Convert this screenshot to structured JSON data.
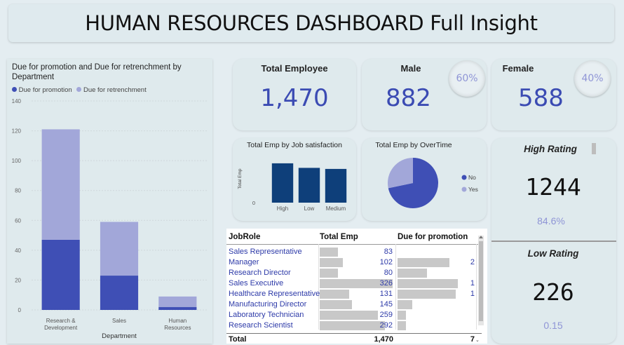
{
  "header": {
    "title": "HUMAN RESOURCES DASHBOARD Full Insight"
  },
  "kpis": {
    "total_employee": {
      "label": "Total Employee",
      "value": "1,470"
    },
    "male": {
      "label": "Male",
      "value": "882",
      "pct": "60%"
    },
    "female": {
      "label": "Female",
      "value": "588",
      "pct": "40%"
    },
    "high_rating": {
      "label": "High Rating",
      "value": "1244",
      "pct": "84.6%"
    },
    "low_rating": {
      "label": "Low Rating",
      "value": "226",
      "pct": "0.15"
    }
  },
  "colors": {
    "dark_blue": "#3f4fb5",
    "light_blue": "#a2a7d9",
    "navy": "#0e3f7a",
    "gray_bar": "#c8c8c8"
  },
  "chart_data": [
    {
      "type": "bar",
      "stacked": true,
      "title": "Due for promotion and Due for retrenchment by Department",
      "xlabel": "Department",
      "ylabel": "",
      "ylim": [
        0,
        140
      ],
      "yticks": [
        "0",
        "20",
        "40",
        "60",
        "80",
        "100",
        "120",
        "140"
      ],
      "categories": [
        "Research & Development",
        "Sales",
        "Human Resources"
      ],
      "category_lines": [
        [
          "Research &",
          "Development"
        ],
        [
          "Sales"
        ],
        [
          "Human",
          "Resources"
        ]
      ],
      "series": [
        {
          "name": "Due for promotion",
          "values": [
            47,
            23,
            2
          ]
        },
        {
          "name": "Due for retrenchment",
          "values": [
            74,
            36,
            7
          ]
        }
      ],
      "legend_position": "top-left"
    },
    {
      "type": "bar",
      "title": "Total Emp by Job satisfaction",
      "ylabel": "Total Emp",
      "yticks": [
        "0"
      ],
      "ylim": [
        0,
        700
      ],
      "categories": [
        "High",
        "Low",
        "Medium"
      ],
      "values": [
        561,
        496,
        481
      ]
    },
    {
      "type": "pie",
      "title": "Total Emp by OverTime",
      "categories": [
        "No",
        "Yes"
      ],
      "values": [
        1054,
        416
      ],
      "legend_position": "right"
    },
    {
      "type": "table",
      "columns": [
        "JobRole",
        "Total Emp",
        "Due for promotion"
      ],
      "rows": [
        {
          "role": "Sales Representative",
          "total": 83,
          "total_label": "83",
          "promo": 0,
          "promo_label": ""
        },
        {
          "role": "Manager",
          "total": 102,
          "total_label": "102",
          "promo": 25,
          "promo_label": "2"
        },
        {
          "role": "Research Director",
          "total": 80,
          "total_label": "80",
          "promo": 14,
          "promo_label": ""
        },
        {
          "role": "Sales Executive",
          "total": 326,
          "total_label": "326",
          "promo": 29,
          "promo_label": "1"
        },
        {
          "role": "Healthcare Representative",
          "total": 131,
          "total_label": "131",
          "promo": 28,
          "promo_label": "1"
        },
        {
          "role": "Manufacturing Director",
          "total": 145,
          "total_label": "145",
          "promo": 7,
          "promo_label": ""
        },
        {
          "role": "Laboratory Technician",
          "total": 259,
          "total_label": "259",
          "promo": 4,
          "promo_label": ""
        },
        {
          "role": "Research Scientist",
          "total": 292,
          "total_label": "292",
          "promo": 4,
          "promo_label": ""
        }
      ],
      "total_label": "Total",
      "total_value": "1,470",
      "total_promo": "7"
    }
  ]
}
